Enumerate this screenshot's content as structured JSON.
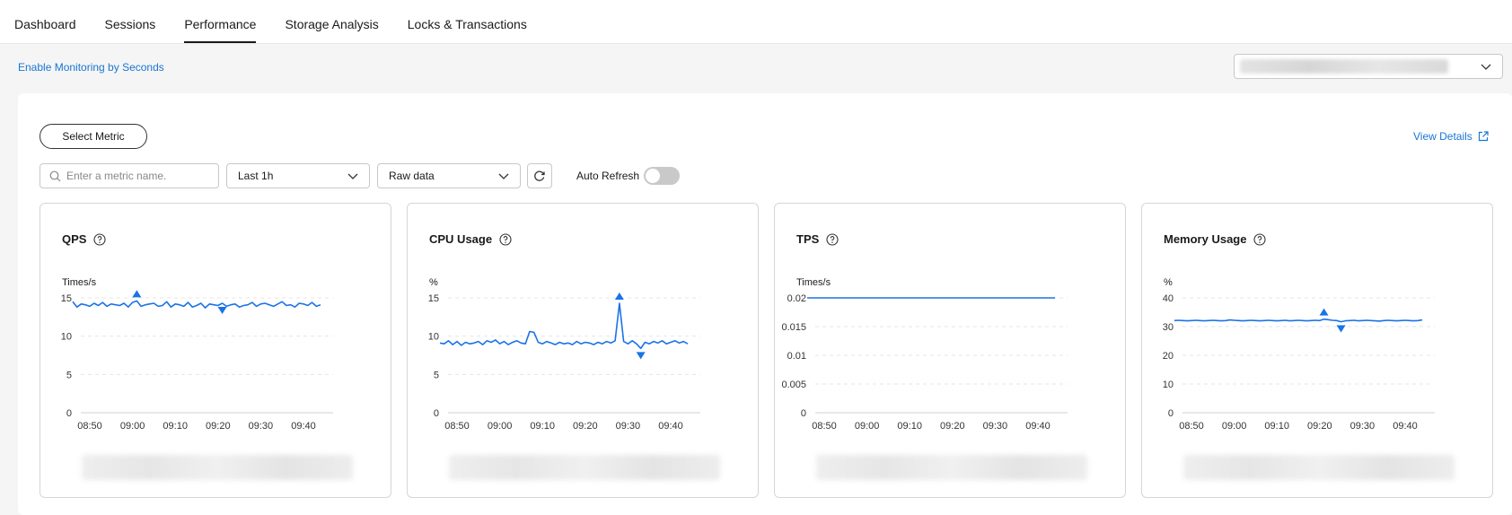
{
  "nav": {
    "tabs": [
      {
        "label": "Dashboard"
      },
      {
        "label": "Sessions"
      },
      {
        "label": "Performance",
        "active": true
      },
      {
        "label": "Storage Analysis"
      },
      {
        "label": "Locks & Transactions"
      }
    ]
  },
  "subbar": {
    "enable_link": "Enable Monitoring by Seconds"
  },
  "toolbar": {
    "select_metric": "Select Metric",
    "view_details": "View Details",
    "search_placeholder": "Enter a metric name.",
    "time_range": "Last 1h",
    "data_mode": "Raw data",
    "auto_refresh_label": "Auto Refresh",
    "auto_refresh_on": false
  },
  "colors": {
    "accent": "#1976d2",
    "series": "#1a73e8"
  },
  "cards": [
    {
      "title": "QPS",
      "unit": "Times/s"
    },
    {
      "title": "CPU Usage",
      "unit": "%"
    },
    {
      "title": "TPS",
      "unit": "Times/s"
    },
    {
      "title": "Memory Usage",
      "unit": "%"
    }
  ],
  "chart_data": [
    {
      "type": "line",
      "title": "QPS",
      "ylabel": "Times/s",
      "ylim": [
        0,
        15
      ],
      "yticks": [
        0,
        5,
        10,
        15
      ],
      "xticks": [
        "08:50",
        "09:00",
        "09:10",
        "09:20",
        "09:30",
        "09:40"
      ],
      "x_range": [
        46,
        104
      ],
      "series": [
        {
          "values": [
            14.5,
            13.8,
            14.2,
            14.1,
            13.9,
            14.3,
            14.0,
            14.4,
            13.9,
            14.2,
            14.1,
            14.0,
            14.3,
            13.8,
            14.4,
            14.6,
            13.9,
            14.1,
            14.2,
            14.3,
            13.9,
            14.0,
            14.5,
            13.8,
            14.2,
            14.1,
            13.9,
            14.4,
            13.8,
            14.0,
            14.3,
            13.7,
            14.2,
            14.1,
            14.0,
            14.3,
            13.9,
            14.1,
            14.2,
            13.8,
            14.0,
            14.1,
            14.4,
            13.9,
            14.2,
            14.3,
            14.1,
            13.9,
            14.2,
            14.5,
            14.0,
            14.1,
            13.8,
            14.3,
            14.2,
            14.0,
            14.4,
            13.9,
            14.1
          ]
        }
      ],
      "max_marker_index": 15,
      "min_marker_index": 35
    },
    {
      "type": "line",
      "title": "CPU Usage",
      "ylabel": "%",
      "ylim": [
        0,
        15
      ],
      "yticks": [
        0,
        5,
        10,
        15
      ],
      "xticks": [
        "08:50",
        "09:00",
        "09:10",
        "09:20",
        "09:30",
        "09:40"
      ],
      "x_range": [
        46,
        104
      ],
      "series": [
        {
          "values": [
            9.1,
            9.0,
            9.4,
            8.9,
            9.3,
            8.8,
            9.2,
            9.0,
            9.1,
            9.3,
            8.9,
            9.4,
            9.2,
            9.5,
            9.0,
            9.3,
            8.9,
            9.2,
            9.4,
            9.1,
            9.0,
            10.6,
            10.5,
            9.2,
            9.0,
            9.3,
            9.1,
            8.9,
            9.2,
            9.0,
            9.1,
            8.9,
            9.3,
            9.0,
            9.2,
            9.1,
            8.9,
            9.2,
            9.0,
            9.3,
            9.1,
            9.4,
            14.3,
            9.3,
            9.0,
            9.4,
            9.0,
            8.4,
            9.2,
            9.0,
            9.3,
            9.1,
            9.4,
            9.0,
            9.2,
            9.4,
            9.1,
            9.3,
            9.0
          ]
        }
      ],
      "max_marker_index": 42,
      "min_marker_index": 47
    },
    {
      "type": "line",
      "title": "TPS",
      "ylabel": "Times/s",
      "ylim": [
        0,
        0.02
      ],
      "yticks": [
        0,
        0.005,
        0.01,
        0.015,
        0.02
      ],
      "xticks": [
        "08:50",
        "09:00",
        "09:10",
        "09:20",
        "09:30",
        "09:40"
      ],
      "x_range": [
        46,
        104
      ],
      "series": [
        {
          "values": [
            0.02,
            0.02,
            0.02,
            0.02,
            0.02,
            0.02,
            0.02,
            0.02,
            0.02,
            0.02,
            0.02,
            0.02,
            0.02,
            0.02,
            0.02,
            0.02,
            0.02,
            0.02,
            0.02,
            0.02,
            0.02,
            0.02,
            0.02,
            0.02,
            0.02,
            0.02,
            0.02,
            0.02,
            0.02,
            0.02,
            0.02,
            0.02,
            0.02,
            0.02,
            0.02,
            0.02,
            0.02,
            0.02,
            0.02,
            0.02,
            0.02,
            0.02,
            0.02,
            0.02,
            0.02,
            0.02,
            0.02,
            0.02,
            0.02,
            0.02,
            0.02,
            0.02,
            0.02,
            0.02,
            0.02,
            0.02,
            0.02,
            0.02,
            0.02
          ]
        }
      ]
    },
    {
      "type": "line",
      "title": "Memory Usage",
      "ylabel": "%",
      "ylim": [
        0,
        40
      ],
      "yticks": [
        0,
        10,
        20,
        30,
        40
      ],
      "xticks": [
        "08:50",
        "09:00",
        "09:10",
        "09:20",
        "09:30",
        "09:40"
      ],
      "x_range": [
        46,
        104
      ],
      "series": [
        {
          "values": [
            32.1,
            32.2,
            32.1,
            32.0,
            32.1,
            32.2,
            32.1,
            32.0,
            32.1,
            32.2,
            32.1,
            32.0,
            32.1,
            32.3,
            32.2,
            32.1,
            32.0,
            32.1,
            32.2,
            32.1,
            32.0,
            32.1,
            32.2,
            32.1,
            32.0,
            32.1,
            32.2,
            32.0,
            32.1,
            32.2,
            32.1,
            32.0,
            32.1,
            32.2,
            32.1,
            32.6,
            32.4,
            32.2,
            32.1,
            31.7,
            32.0,
            32.1,
            32.2,
            32.0,
            32.1,
            32.2,
            32.1,
            32.0,
            31.9,
            32.1,
            32.2,
            32.1,
            32.0,
            32.1,
            32.2,
            32.1,
            32.0,
            32.1,
            32.3
          ]
        }
      ],
      "max_marker_index": 35,
      "min_marker_index": 39
    }
  ]
}
